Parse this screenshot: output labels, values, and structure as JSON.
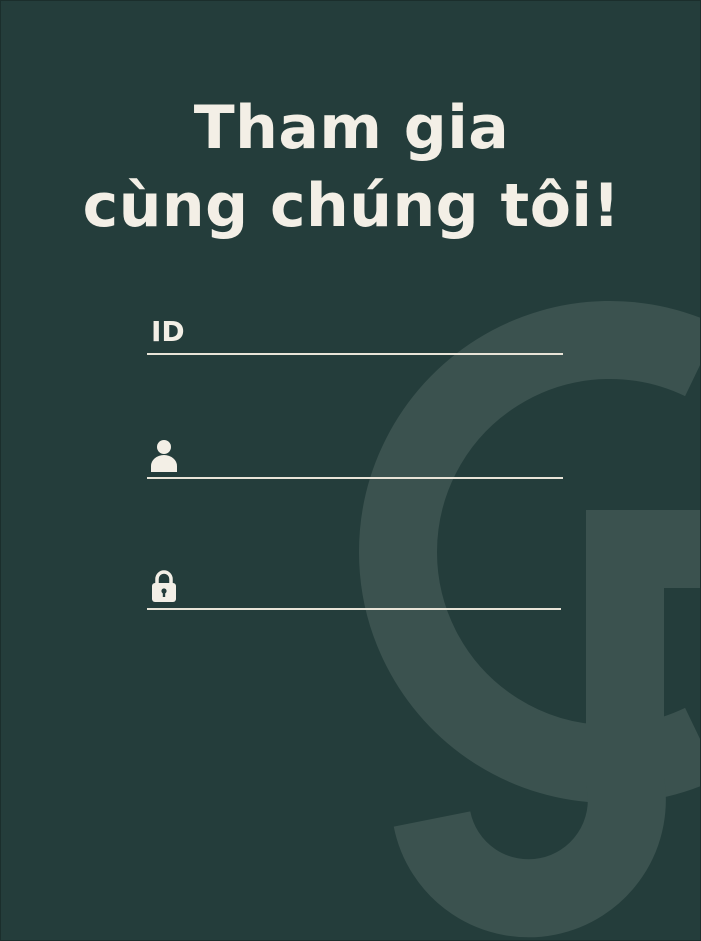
{
  "heading": {
    "line1": "Tham gia",
    "line2": "cùng chúng tôi!"
  },
  "form": {
    "id_field": {
      "label": "ID",
      "value": "",
      "placeholder": ""
    },
    "username_field": {
      "icon": "user-icon",
      "value": "",
      "placeholder": ""
    },
    "password_field": {
      "icon": "lock-icon",
      "value": "",
      "placeholder": ""
    }
  },
  "colors": {
    "background": "#243d3b",
    "foreground": "#f3efe6",
    "watermark": "#3b524f"
  }
}
